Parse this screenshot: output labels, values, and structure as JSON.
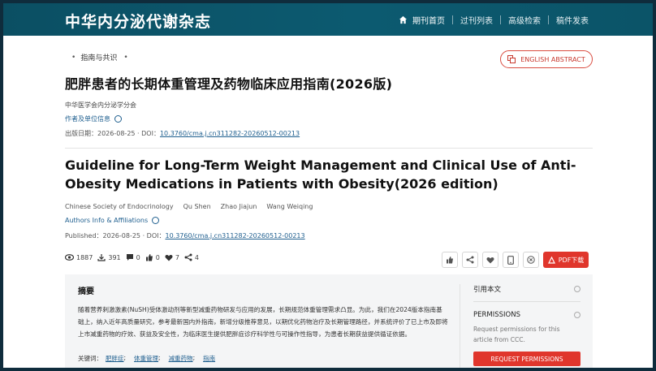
{
  "header": {
    "site_title": "中华内分泌代谢杂志",
    "nav": [
      {
        "label": "期刊首页",
        "icon": "home-icon"
      },
      {
        "label": "过刊列表"
      },
      {
        "label": "高级检索"
      },
      {
        "label": "稿件发表"
      }
    ]
  },
  "article": {
    "category": "指南与共识",
    "english_abstract_button": "ENGLISH ABSTRACT",
    "cn_title": "肥胖患者的长期体重管理及药物临床应用指南(2026版)",
    "cn_org": "中华医学会内分泌学分会",
    "cn_authors_info": "作者及单位信息",
    "cn_published_label": "出版日期：",
    "cn_published_date": "2026-08-25",
    "cn_doi_label": "DOI：",
    "doi": "10.3760/cma.j.cn311282-20260512-00213",
    "en_title": "Guideline for Long-Term Weight Management and Clinical Use of Anti-Obesity Medications in Patients with Obesity(2026 edition)",
    "en_authors": [
      "Chinese Society of Endocrinology",
      "Qu Shen",
      "Zhao Jiajun",
      "Wang Weiqing"
    ],
    "en_authors_info": "Authors Info & Affiliations",
    "en_published_label": "Published：",
    "en_published_date": "2026-08-25",
    "en_doi_label": "DOI：",
    "stats": {
      "views": "1887",
      "downloads": "391",
      "comments": "0",
      "likes": "0",
      "favorites": "7",
      "shares": "4"
    },
    "pdf_button": "PDF下载"
  },
  "abstract": {
    "title": "摘要",
    "text": "随着营养刺激激素(NuSH)受体激动剂等新型减重药物研发与应用的发展，长期规范体重管理需求凸显。为此，我们在2024版本指南基础上，纳入近年高质量研究，参考最新国内外指南，新增分级推荐意见，以期优化药物治疗及长期管理路径，并系统评价了已上市及即将上市减重药物的疗效、获益及安全性，为临床医生提供肥胖症诊疗科学性与可操作性指导，为患者长期获益提供循证依据。",
    "keywords_label": "关键词：",
    "keywords": [
      "肥胖症",
      "体重管理",
      "减重药物",
      "指南"
    ],
    "side": {
      "cite_label": "引用本文",
      "permissions_label": "PERMISSIONS",
      "permissions_text": "Request permissions for this article from CCC.",
      "request_button": "REQUEST PERMISSIONS"
    }
  },
  "colors": {
    "header": "#0b5468",
    "accent": "#e0362c",
    "link": "#1f5f8f"
  }
}
